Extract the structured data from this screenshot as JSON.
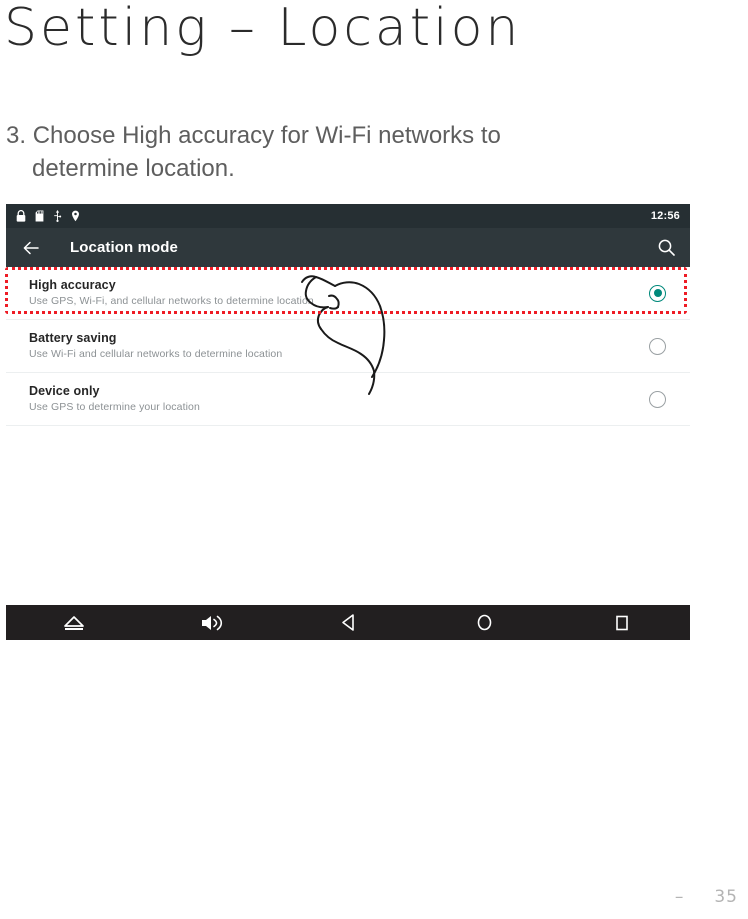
{
  "page": {
    "title": "Setting – Location",
    "footer_dash": "–",
    "footer_number": "35"
  },
  "instruction": {
    "number": "3.",
    "line1": "Choose High accuracy for Wi-Fi networks to",
    "line2": "determine location."
  },
  "device": {
    "status_bar": {
      "time": "12:56",
      "icons": [
        "lock-icon",
        "sdcard-icon",
        "usb-icon",
        "location-pin-icon"
      ]
    },
    "toolbar": {
      "back_icon": "back-arrow-icon",
      "title": "Location mode",
      "search_icon": "search-icon"
    },
    "list_items": [
      {
        "primary": "High accuracy",
        "secondary": "Use GPS, Wi-Fi, and cellular networks to determine location",
        "selected": true
      },
      {
        "primary": "Battery saving",
        "secondary": "Use Wi-Fi and cellular networks to determine location",
        "selected": false
      },
      {
        "primary": "Device only",
        "secondary": "Use GPS to determine your location",
        "selected": false
      }
    ],
    "nav_bar": {
      "buttons": [
        "eject-icon",
        "volume-icon",
        "back-triangle-icon",
        "home-circle-icon",
        "recents-square-icon"
      ]
    }
  },
  "annotation": {
    "highlight_color": "#ee1c25",
    "highlight_target": "High accuracy",
    "gesture": "pointing-hand-tap"
  },
  "colors": {
    "accent_selected": "#00897b",
    "status_bar": "#262f33",
    "toolbar": "#2f383c",
    "nav_bar": "#221f20",
    "heading_text": "#2b2b2b",
    "body_text": "#5e5e5e"
  }
}
